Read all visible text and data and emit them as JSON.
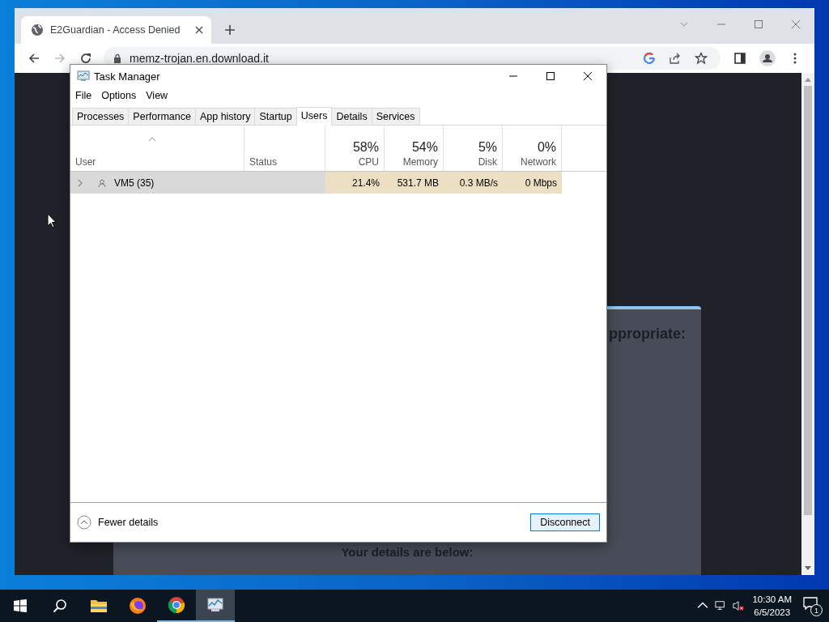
{
  "browser": {
    "tabs": [
      {
        "title": "E2Guardian - Access Denied",
        "selected": true
      }
    ],
    "address": "memz-trojan.en.download.it",
    "page": {
      "heading_fragment": "ppropriate:",
      "details": "Your details are below:"
    }
  },
  "task_manager": {
    "title": "Task Manager",
    "menu": [
      "File",
      "Options",
      "View"
    ],
    "tabs": [
      {
        "label": "Processes",
        "selected": false
      },
      {
        "label": "Performance",
        "selected": false
      },
      {
        "label": "App history",
        "selected": false
      },
      {
        "label": "Startup",
        "selected": false
      },
      {
        "label": "Users",
        "selected": true
      },
      {
        "label": "Details",
        "selected": false
      },
      {
        "label": "Services",
        "selected": false
      }
    ],
    "columns": [
      {
        "label": "User",
        "sorted": true
      },
      {
        "label": "Status"
      },
      {
        "label": "CPU",
        "total": "58%"
      },
      {
        "label": "Memory",
        "total": "54%"
      },
      {
        "label": "Disk",
        "total": "5%"
      },
      {
        "label": "Network",
        "total": "0%"
      }
    ],
    "rows": [
      {
        "user": "VM5 (35)",
        "expanded": false,
        "selected": true,
        "cpu": "21.4%",
        "memory": "531.7 MB",
        "disk": "0.3 MB/s",
        "network": "0 Mbps"
      }
    ],
    "fewer_details": "Fewer details",
    "disconnect": "Disconnect"
  },
  "taskbar": {
    "apps": [
      {
        "kind": "explorer",
        "running": false,
        "active": false
      },
      {
        "kind": "firefox",
        "running": false,
        "active": false
      },
      {
        "kind": "chrome",
        "running": true,
        "active": false
      },
      {
        "kind": "taskmgr",
        "running": true,
        "active": true
      }
    ],
    "time": "10:30 AM",
    "date": "6/5/2023",
    "notifications": "1"
  }
}
